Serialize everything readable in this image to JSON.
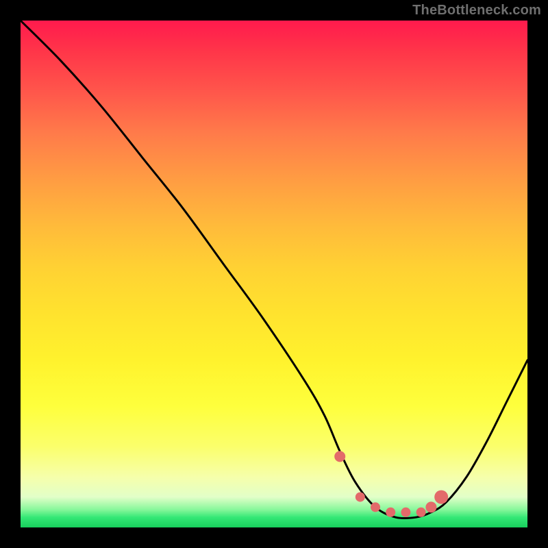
{
  "watermark": "TheBottleneck.com",
  "chart_data": {
    "type": "line",
    "title": "",
    "xlabel": "",
    "ylabel": "",
    "xlim": [
      0,
      100
    ],
    "ylim": [
      0,
      100
    ],
    "grid": false,
    "series": [
      {
        "name": "curve",
        "x": [
          0,
          8,
          16,
          24,
          32,
          40,
          48,
          56,
          60,
          63,
          66,
          70,
          74,
          78,
          81,
          84,
          88,
          92,
          96,
          100
        ],
        "values": [
          100,
          92,
          83,
          73,
          63,
          52,
          41,
          29,
          22,
          15,
          9,
          4,
          2,
          2,
          3,
          5,
          10,
          17,
          25,
          33
        ]
      }
    ],
    "markers": {
      "name": "dots",
      "x": [
        63,
        67,
        70,
        73,
        76,
        79,
        81,
        83
      ],
      "values": [
        14,
        6,
        4,
        3,
        3,
        3,
        4,
        6
      ],
      "radius": [
        8,
        7,
        7,
        7,
        7,
        7,
        8,
        10
      ]
    },
    "colors": {
      "curve": "#000000",
      "markers": "#e36a6a",
      "gradient_top": "#ff1a4d",
      "gradient_bottom": "#17cf5c"
    }
  }
}
